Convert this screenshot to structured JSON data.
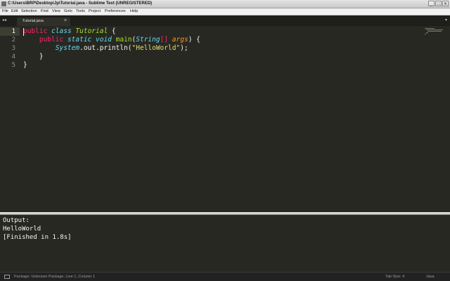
{
  "window": {
    "title": "C:\\Users\\BRP\\Desktop\\Jp\\Tutorial.java - Sublime Text (UNREGISTERED)",
    "minimize": "_",
    "maximize": "□",
    "close": "✕"
  },
  "menu": [
    "File",
    "Edit",
    "Selection",
    "Find",
    "View",
    "Goto",
    "Tools",
    "Project",
    "Preferences",
    "Help"
  ],
  "tabs": {
    "nav": "◂▸",
    "active_label": "Tutorial.java",
    "close": "×",
    "menu": "▾"
  },
  "editor": {
    "line_numbers": [
      "1",
      "2",
      "3",
      "4",
      "5"
    ],
    "lines": [
      "public class Tutorial {",
      "    public static void main(String[] args) {",
      "        System.out.println(\"HelloWorld\");",
      "    }",
      "}"
    ]
  },
  "output": {
    "lines": [
      "Output:",
      "HelloWorld",
      "[Finished in 1.8s]"
    ]
  },
  "status": {
    "left": "Package: Unknown Package, Line 1, Column 1",
    "tab_size": "Tab Size: 4",
    "syntax": "Java"
  },
  "theme": {
    "background": "#272822",
    "keyword": "#f92672",
    "storage": "#66d9ef",
    "function": "#a6e22e",
    "parameter": "#fd971f",
    "string": "#e6db74"
  }
}
